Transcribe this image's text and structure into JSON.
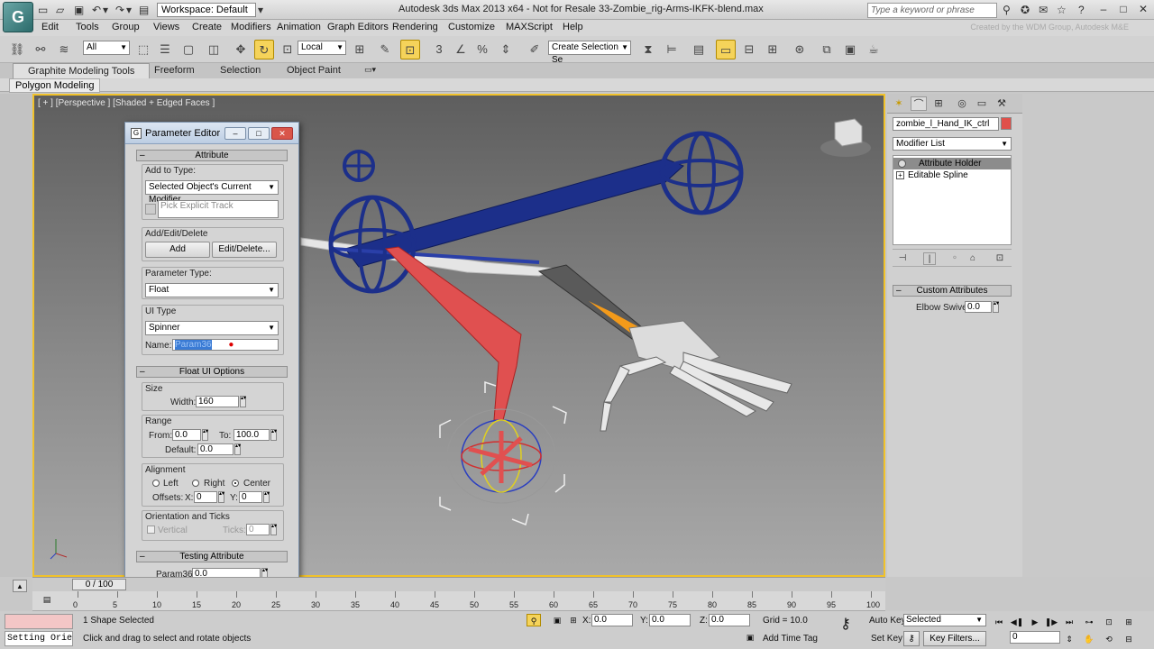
{
  "app": {
    "logo": "3ds-max-logo",
    "title": "Autodesk 3ds Max 2013 x64    -  Not for Resale   33-Zombie_rig-Arms-IKFK-blend.max",
    "workspace": "Workspace: Default",
    "search_placeholder": "Type a keyword or phrase",
    "watermark": "Created by the WDM Group, Autodesk M&E"
  },
  "menu": [
    "Edit",
    "Tools",
    "Group",
    "Views",
    "Create",
    "Modifiers",
    "Animation",
    "Graph Editors",
    "Rendering",
    "Customize",
    "MAXScript",
    "Help"
  ],
  "toolbar": {
    "selection_filter": "All",
    "ref_coord": "Local",
    "named_selection": "Create Selection Se"
  },
  "ribbon": {
    "tabs": [
      "Graphite Modeling Tools",
      "Freeform",
      "Selection",
      "Object Paint"
    ],
    "sub": "Polygon Modeling"
  },
  "viewport": {
    "label": "[ + ] [Perspective ] [Shaded + Edged Faces ]",
    "active_border": "#f1c22a"
  },
  "param_editor": {
    "title": "Parameter Editor",
    "attribute_rollout": "Attribute",
    "add_to_type_label": "Add to Type:",
    "add_to_type_value": "Selected Object's Current Modifier",
    "pick_track_label": "Pick Explicit Track",
    "add_edit_delete_label": "Add/Edit/Delete",
    "add_button": "Add",
    "edit_delete_button": "Edit/Delete...",
    "param_type_label": "Parameter Type:",
    "param_type_value": "Float",
    "ui_type_label": "UI Type",
    "ui_type_value": "Spinner",
    "name_label": "Name:",
    "name_value": "Param36",
    "float_ui_rollout": "Float UI Options",
    "size_label": "Size",
    "width_label": "Width:",
    "width_value": "160",
    "range_label": "Range",
    "from_label": "From:",
    "from_value": "0.0",
    "to_label": "To:",
    "to_value": "100.0",
    "default_label": "Default:",
    "default_value": "0.0",
    "alignment_label": "Alignment",
    "align_left": "Left",
    "align_right": "Right",
    "align_center": "Center",
    "offsets_label": "Offsets:",
    "offset_x_label": "X:",
    "offset_x": "0",
    "offset_y_label": "Y:",
    "offset_y": "0",
    "orientation_label": "Orientation and Ticks",
    "vertical_label": "Vertical",
    "ticks_label": "Ticks:",
    "ticks_value": "0",
    "testing_rollout": "Testing Attribute",
    "test_param_label": "Param36:",
    "test_param_value": "0.0"
  },
  "command_panel": {
    "object_name": "zombie_l_Hand_IK_ctrl",
    "object_color": "#e0504a",
    "modifier_list": "Modifier List",
    "stack": [
      "Attribute Holder",
      "Editable Spline"
    ],
    "custom_rollout": "Custom Attributes",
    "elbow_label": "Elbow Swivel:",
    "elbow_value": "0.0"
  },
  "timeline": {
    "slider": "0 / 100",
    "ticks": [
      "0",
      "5",
      "10",
      "15",
      "20",
      "25",
      "30",
      "35",
      "40",
      "45",
      "50",
      "55",
      "60",
      "65",
      "70",
      "75",
      "80",
      "85",
      "90",
      "95",
      "100"
    ]
  },
  "status": {
    "maxscript": "Setting Orie",
    "selected": "1 Shape Selected",
    "prompt": "Click and drag to select and rotate objects",
    "x_label": "X:",
    "x": "0.0",
    "y_label": "Y:",
    "y": "0.0",
    "z_label": "Z:",
    "z": "0.0",
    "grid": "Grid = 10.0",
    "add_time_tag": "Add Time Tag",
    "auto_key": "Auto Key",
    "set_key": "Set Key",
    "key_mode": "Selected",
    "key_filters": "Key Filters...",
    "frame": "0"
  }
}
